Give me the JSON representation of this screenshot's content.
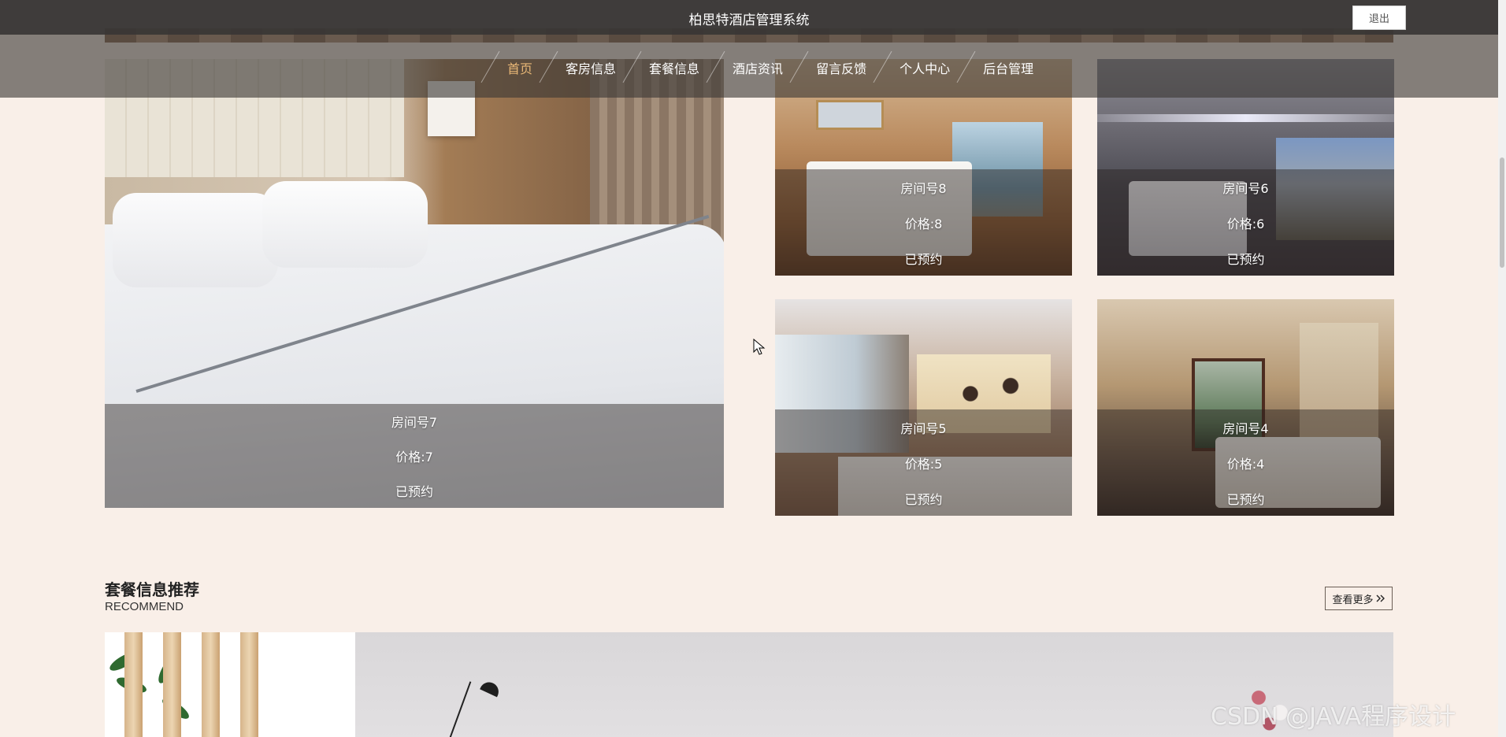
{
  "header": {
    "title": "柏思特酒店管理系统",
    "logout_label": "退出",
    "nav": [
      {
        "label": "首页",
        "active": true
      },
      {
        "label": "客房信息",
        "active": false
      },
      {
        "label": "套餐信息",
        "active": false
      },
      {
        "label": "酒店资讯",
        "active": false
      },
      {
        "label": "留言反馈",
        "active": false
      },
      {
        "label": "个人中心",
        "active": false
      },
      {
        "label": "后台管理",
        "active": false
      }
    ],
    "active_color": "#e8b776"
  },
  "rooms": [
    {
      "room_no": "房间号7",
      "price": "价格:7",
      "status": "已预约"
    },
    {
      "room_no": "房间号8",
      "price": "价格:8",
      "status": "已预约"
    },
    {
      "room_no": "房间号6",
      "price": "价格:6",
      "status": "已预约"
    },
    {
      "room_no": "房间号5",
      "price": "价格:5",
      "status": "已预约"
    },
    {
      "room_no": "房间号4",
      "price": "价格:4",
      "status": "已预约"
    }
  ],
  "recommend": {
    "title": "套餐信息推荐",
    "subtitle": "RECOMMEND",
    "more_label": "查看更多",
    "more_icon": "double-chevron-right-icon"
  },
  "watermark": "CSDN @JAVA程序设计",
  "colors": {
    "page_bg": "#f9efe8",
    "header_bg": "#3c3836"
  }
}
